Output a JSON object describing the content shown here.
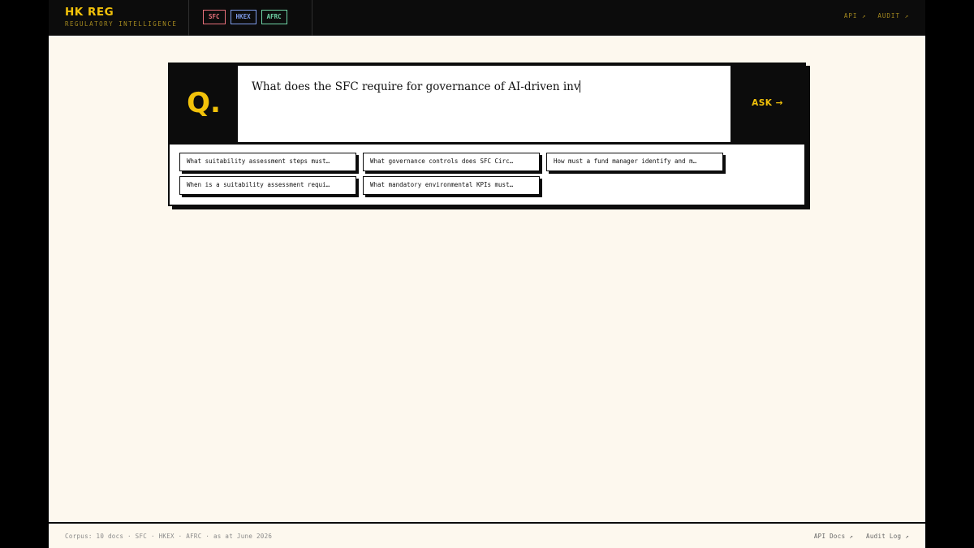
{
  "header": {
    "brand_title": "HK REG",
    "brand_subtitle": "REGULATORY INTELLIGENCE",
    "tags": [
      "SFC",
      "HKEX",
      "AFRC"
    ],
    "nav": [
      "API ↗",
      "AUDIT ↗"
    ]
  },
  "ask": {
    "q_label": "Q.",
    "input_value": "What does the SFC require for governance of AI-driven inv",
    "button_label": "ASK →"
  },
  "suggestions": [
    "What suitability assessment steps must…",
    "What governance controls does SFC Circ…",
    "How must a fund manager identify and m…",
    "When is a suitability assessment requi…",
    "What mandatory environmental KPIs must…"
  ],
  "footer": {
    "corpus": "Corpus: 10 docs · SFC · HKEX · AFRC · as at June 2026",
    "links": [
      "API Docs ↗",
      "Audit Log ↗"
    ]
  },
  "colors": {
    "accent": "#f2c20a",
    "sfc": "#e8707a",
    "hkex": "#7e9ceb",
    "afrc": "#6fd4a6",
    "background": "#fdf8ee"
  }
}
